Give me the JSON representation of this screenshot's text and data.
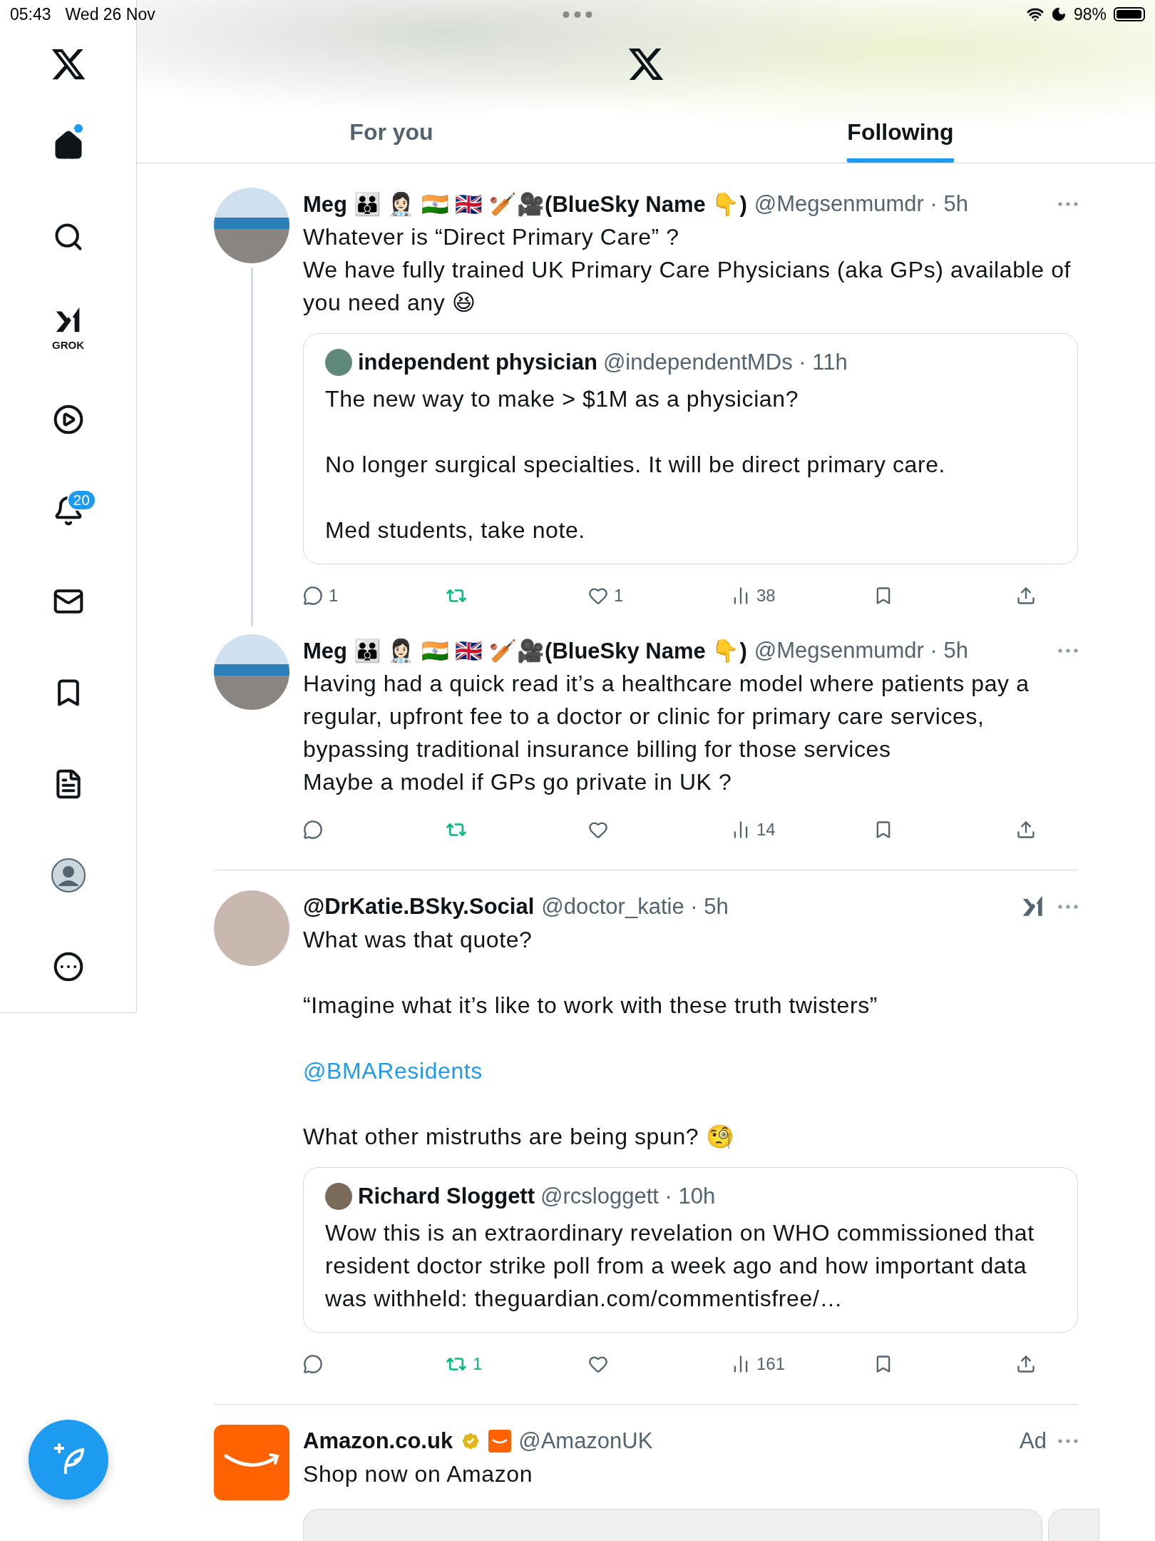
{
  "status_bar": {
    "time": "05:43",
    "date": "Wed 26 Nov",
    "battery": "98%"
  },
  "sidebar": {
    "items": [
      {
        "kind": "logo"
      },
      {
        "kind": "home",
        "unread": true
      },
      {
        "kind": "search"
      },
      {
        "kind": "grok",
        "label": "GROK"
      },
      {
        "kind": "video"
      },
      {
        "kind": "notifications",
        "badge": "20"
      },
      {
        "kind": "messages"
      },
      {
        "kind": "bookmarks"
      },
      {
        "kind": "lists"
      },
      {
        "kind": "profile"
      },
      {
        "kind": "more"
      }
    ]
  },
  "tabs": [
    {
      "label": "For you",
      "selected": false
    },
    {
      "label": "Following",
      "selected": true
    }
  ],
  "tweets": [
    {
      "kind": "post",
      "name": "Meg 👪 👩🏻‍⚕️ 🇮🇳 🇬🇧 🏏🎥(BlueSky Name 👇)",
      "meta": "@Megsenmumdr · 5h",
      "thread_continues": true,
      "paragraphs": [
        {
          "kind": "text",
          "lines": [
            "Whatever is “Direct Primary Care” ?",
            "We have fully trained UK Primary Care Physicians (aka GPs) available of you need any 😆"
          ]
        }
      ],
      "quote": {
        "name": "independent physician",
        "meta": "@independentMDs · 11h",
        "paragraphs": [
          "The new way to make > $1M as a physician?",
          "No longer surgical specialties. It will be direct primary care.",
          "Med students, take note."
        ]
      },
      "actions": {
        "replies": "1",
        "likes": "1",
        "views": "38",
        "retweeted": true
      }
    },
    {
      "kind": "post",
      "name": "Meg 👪 👩🏻‍⚕️ 🇮🇳 🇬🇧 🏏🎥(BlueSky Name 👇)",
      "meta": "@Megsenmumdr · 5h",
      "paragraphs": [
        {
          "kind": "text",
          "lines": [
            "Having had a quick read it’s a healthcare model where patients pay a regular, upfront fee to a doctor or clinic for primary care services, bypassing traditional insurance billing for those services",
            "Maybe a model if GPs go private in UK ?"
          ]
        }
      ],
      "actions": {
        "views": "14",
        "retweeted": true
      }
    },
    {
      "kind": "post",
      "name": "@DrKatie.BSky.Social",
      "meta": "@doctor_katie · 5h",
      "grok_button": true,
      "divider": true,
      "paragraphs": [
        {
          "kind": "text",
          "lines": [
            "What was that quote?"
          ]
        },
        {
          "kind": "text",
          "lines": [
            "“Imagine what it’s like to work with these truth twisters”"
          ]
        },
        {
          "kind": "link",
          "lines": [
            "@BMAResidents"
          ]
        },
        {
          "kind": "text",
          "lines": [
            "What other mistruths are being spun? 🧐"
          ]
        }
      ],
      "quote": {
        "name": "Richard Sloggett",
        "meta": "@rcsloggett · 10h",
        "paragraphs": [
          "Wow this is an extraordinary revelation on WHO commissioned that resident doctor strike poll from a week ago and how important data was withheld: theguardian.com/commentisfree/…"
        ]
      },
      "actions": {
        "retweets": "1",
        "views": "161",
        "retweeted": true
      }
    },
    {
      "kind": "ad",
      "name": "Amazon.co.uk",
      "verified": true,
      "brand_badge": true,
      "meta": "@AmazonUK",
      "ad_label": "Ad",
      "divider": true,
      "paragraphs": [
        {
          "kind": "text",
          "lines": [
            "Shop now on Amazon"
          ]
        }
      ]
    }
  ]
}
